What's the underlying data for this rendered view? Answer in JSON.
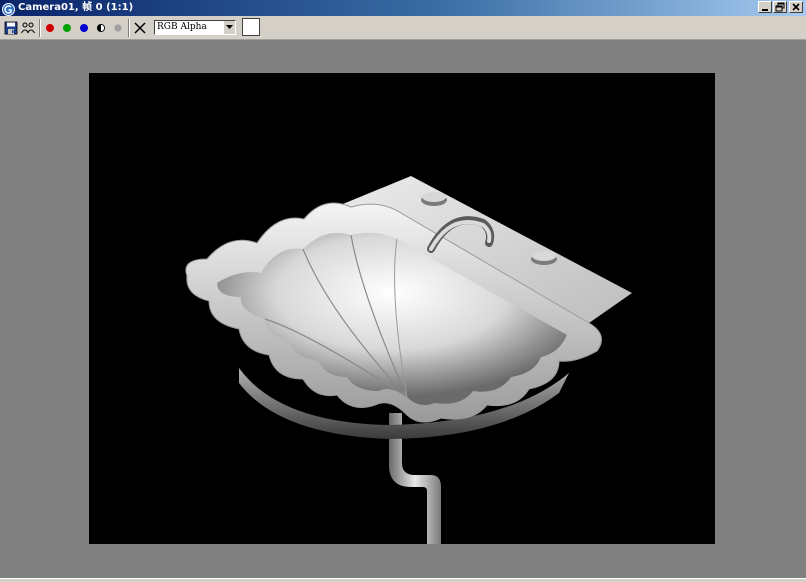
{
  "window": {
    "title": "Camera01, 帧 0 (1:1)"
  },
  "toolbar": {
    "channel_value": "RGB Alpha",
    "swatch_color": "#ffffff",
    "channel_colors": {
      "red": "#d00000",
      "green": "#00a000",
      "blue": "#0000d0"
    }
  },
  "icons": {
    "save": "floppy-disk-icon",
    "clone": "clone-window-icon",
    "red": "red-channel-icon",
    "green": "green-channel-icon",
    "blue": "blue-channel-icon",
    "alpha": "alpha-channel-icon",
    "mono": "monochrome-icon",
    "clear": "clear-x-icon"
  }
}
